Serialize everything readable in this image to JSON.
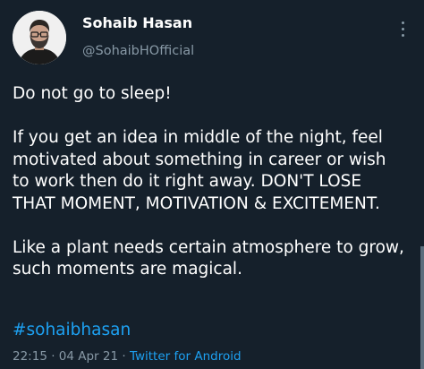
{
  "author": {
    "name": "Sohaib Hasan",
    "handle": "@SohaibHOfficial"
  },
  "tweet": {
    "line1": "Do not go to sleep!",
    "line2": "If you get an idea in middle of the night, feel",
    "line3": "motivated about something in career or wish",
    "line4": "to work then do it right away. DON'T LOSE",
    "line5": "THAT MOMENT, MOTIVATION & EXCITEMENT.",
    "line6": "Like a plant needs certain atmosphere to grow,",
    "line7": "such moments are magical.",
    "hashtag": "#sohaibhasan"
  },
  "meta": {
    "time": "22:15",
    "separator1": " · ",
    "date": "04 Apr 21",
    "separator2": " · ",
    "source": "Twitter for Android"
  },
  "colors": {
    "background": "#15202b",
    "text": "#ffffff",
    "secondary": "#8899a6",
    "accent": "#1da1f2"
  },
  "icons": {
    "more": "more-vertical-icon"
  }
}
